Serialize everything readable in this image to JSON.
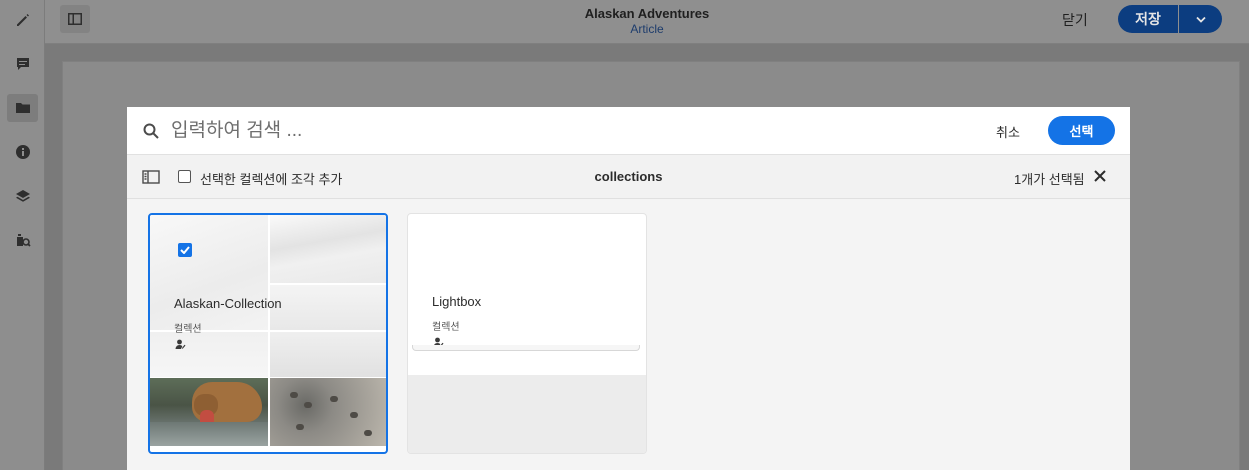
{
  "rail": {
    "items": [
      {
        "name": "edit-icon"
      },
      {
        "name": "comment-icon"
      },
      {
        "name": "folder-icon",
        "active": true
      },
      {
        "name": "info-icon"
      },
      {
        "name": "layers-icon"
      },
      {
        "name": "asset-search-icon"
      }
    ]
  },
  "header": {
    "title": "Alaskan Adventures",
    "subtitle": "Article",
    "close_label": "닫기",
    "save_label": "저장"
  },
  "picker": {
    "search_placeholder": "입력하여 검색 ...",
    "cancel_label": "취소",
    "select_label": "선택",
    "add_label": "선택한 컬렉션에 조각 추가",
    "breadcrumb": "collections",
    "selected_count": "1개가 선택됨",
    "cards": [
      {
        "title": "Alaskan-Collection",
        "type": "컬렉션",
        "selected": true
      },
      {
        "title": "Lightbox",
        "type": "컬렉션",
        "selected": false
      }
    ]
  },
  "colors": {
    "accent": "#1473e6",
    "save_button": "#0c3d80",
    "article_link": "#1d3c6c"
  }
}
